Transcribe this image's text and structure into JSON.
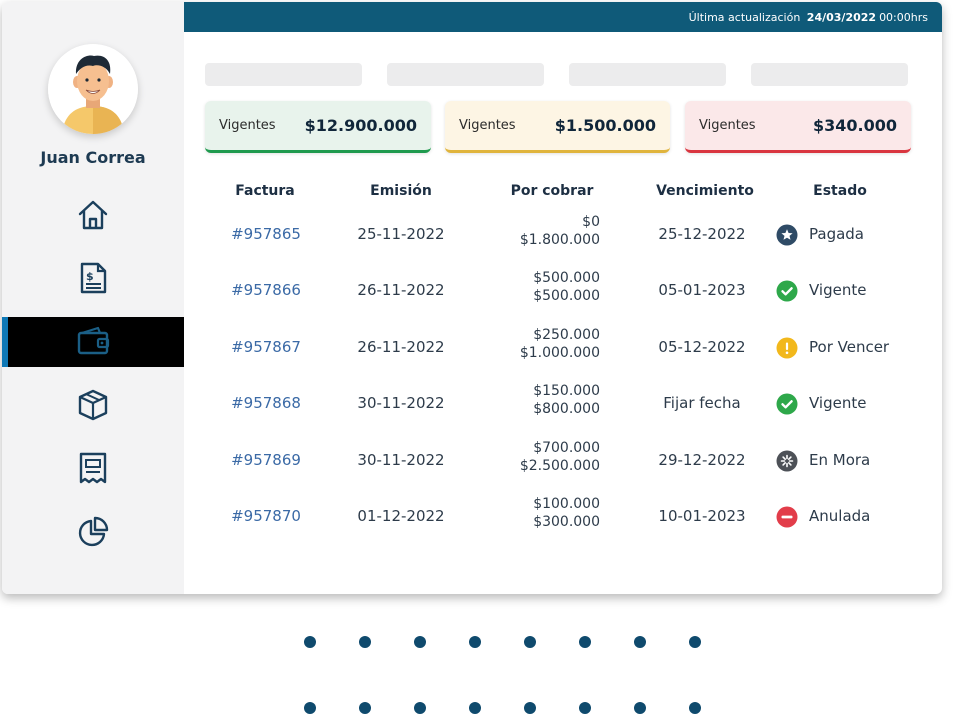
{
  "user": {
    "name": "Juan Correa"
  },
  "topbar": {
    "prefix": "Última actualización",
    "date": "24/03/2022",
    "time": "00:00hrs"
  },
  "summary_cards": [
    {
      "label": "Vigentes",
      "amount": "$12.900.000",
      "bg": "#e8f3ec",
      "border": "#1f9a4e"
    },
    {
      "label": "Vigentes",
      "amount": "$1.500.000",
      "bg": "#fdf5e4",
      "border": "#e0b43c"
    },
    {
      "label": "Vigentes",
      "amount": "$340.000",
      "bg": "#fbe8e9",
      "border": "#d9353f"
    }
  ],
  "nav": [
    {
      "icon": "home-icon"
    },
    {
      "icon": "invoice-icon"
    },
    {
      "icon": "wallet-icon",
      "active": true
    },
    {
      "icon": "box-icon"
    },
    {
      "icon": "receipt-icon"
    },
    {
      "icon": "pie-chart-icon"
    }
  ],
  "table": {
    "headers": [
      "Factura",
      "Emisión",
      "Por cobrar",
      "Vencimiento",
      "Estado"
    ],
    "rows": [
      {
        "invoice": "#957865",
        "issued": "25-11-2022",
        "amount_top": "$0",
        "amount_bottom": "$1.800.000",
        "due": "25-12-2022",
        "status": "Pagada",
        "status_icon": "star-icon",
        "status_color": "#2f4b66"
      },
      {
        "invoice": "#957866",
        "issued": "26-11-2022",
        "amount_top": "$500.000",
        "amount_bottom": "$500.000",
        "due": "05-01-2023",
        "status": "Vigente",
        "status_icon": "check-icon",
        "status_color": "#2ea84a"
      },
      {
        "invoice": "#957867",
        "issued": "26-11-2022",
        "amount_top": "$250.000",
        "amount_bottom": "$1.000.000",
        "due": "05-12-2022",
        "status": "Por Vencer",
        "status_icon": "exclamation-icon",
        "status_color": "#f2b81c"
      },
      {
        "invoice": "#957868",
        "issued": "30-11-2022",
        "amount_top": "$150.000",
        "amount_bottom": "$800.000",
        "due": "Fijar fecha",
        "status": "Vigente",
        "status_icon": "check-icon",
        "status_color": "#2ea84a"
      },
      {
        "invoice": "#957869",
        "issued": "30-11-2022",
        "amount_top": "$700.000",
        "amount_bottom": "$2.500.000",
        "due": "29-12-2022",
        "status": "En Mora",
        "status_icon": "asterisk-icon",
        "status_color": "#4d5157"
      },
      {
        "invoice": "#957870",
        "issued": "01-12-2022",
        "amount_top": "$100.000",
        "amount_bottom": "$300.000",
        "due": "10-01-2023",
        "status": "Anulada",
        "status_icon": "minus-icon",
        "status_color": "#e23d4a"
      }
    ]
  },
  "colors": {
    "topbar": "#0f5a79",
    "nav_icon": "#1b3f5c",
    "invoice_link": "#3b6aa6",
    "dots": "#0f4a6d"
  }
}
